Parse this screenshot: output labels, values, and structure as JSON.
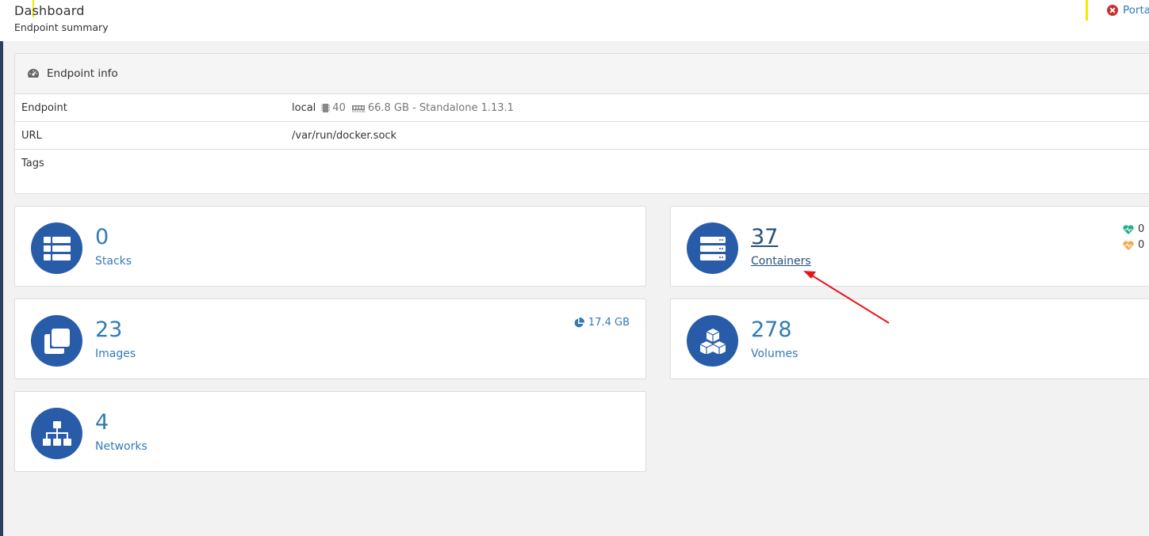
{
  "header": {
    "title": "Dashboard",
    "subtitle": "Endpoint summary",
    "portainer_link": "Porta"
  },
  "endpoint_info": {
    "heading": "Endpoint info",
    "icon": "gauge-icon",
    "rows": [
      {
        "label": "Endpoint",
        "name": "local",
        "cpu": "40",
        "memory": "66.8 GB",
        "mode": "- Standalone 1.13.1"
      },
      {
        "label": "URL",
        "value": "/var/run/docker.sock"
      },
      {
        "label": "Tags",
        "value": ""
      }
    ]
  },
  "widgets": {
    "stacks": {
      "count": "0",
      "label": "Stacks",
      "icon": "list-icon"
    },
    "containers": {
      "count": "37",
      "label": "Containers",
      "icon": "server-icon",
      "healthy": "0",
      "unhealthy": "0"
    },
    "images": {
      "count": "23",
      "label": "Images",
      "icon": "clone-icon",
      "size": "17.4 GB"
    },
    "volumes": {
      "count": "278",
      "label": "Volumes",
      "icon": "cubes-icon"
    },
    "networks": {
      "count": "4",
      "label": "Networks",
      "icon": "sitemap-icon"
    }
  },
  "colors": {
    "accent": "#285ca8",
    "link": "#337ab7",
    "healthy": "#23ae89",
    "unhealthy": "#f0ad4e",
    "annotation_arrow": "#e8141c",
    "header_marker": "#f3e800"
  }
}
